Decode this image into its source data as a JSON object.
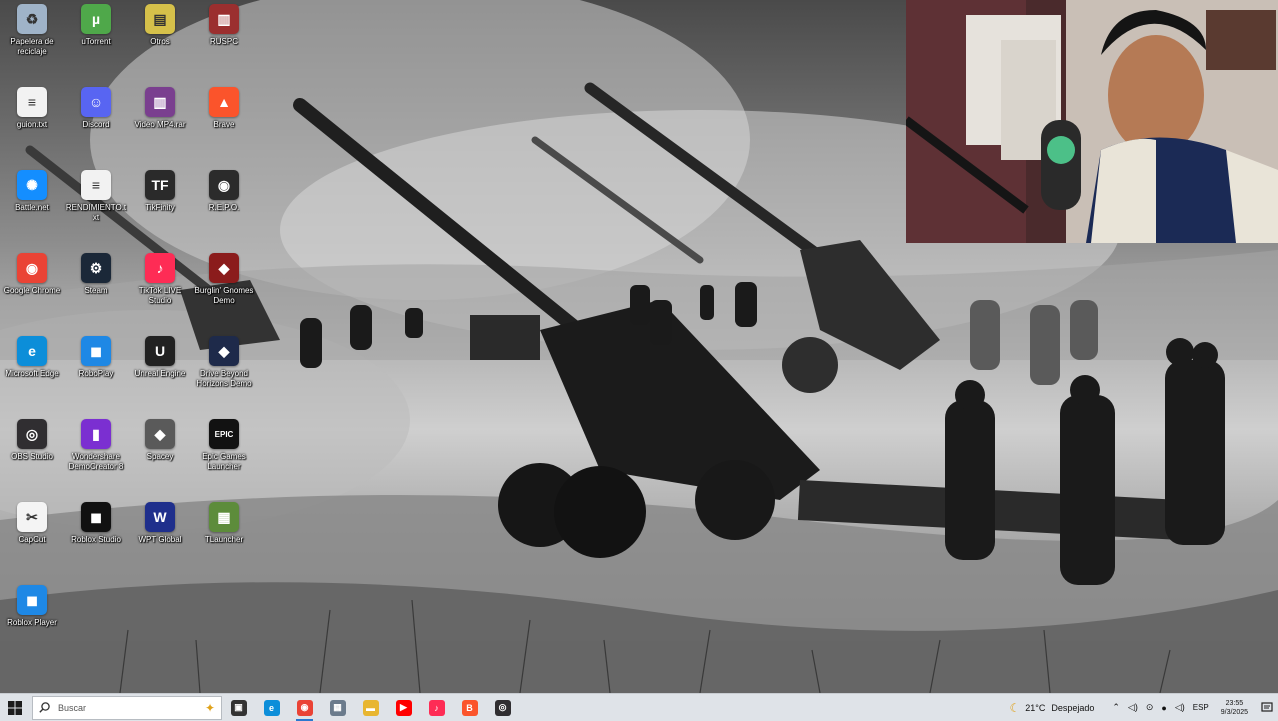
{
  "desktop": {
    "icons": [
      {
        "label": "Papelera de reciclaje",
        "icon": "recycle-bin-icon",
        "color": "#9fb3c8"
      },
      {
        "label": "uTorrent",
        "icon": "utorrent-icon",
        "color": "#4fa84a"
      },
      {
        "label": "Otros",
        "icon": "folder-icon",
        "color": "#d5c04a"
      },
      {
        "label": "RUSPC",
        "icon": "archive-icon",
        "color": "#9b2f2f"
      },
      {
        "label": "guion.txt",
        "icon": "text-file-icon",
        "color": "#f2f2f2"
      },
      {
        "label": "Discord",
        "icon": "discord-icon",
        "color": "#5865f2"
      },
      {
        "label": "Video MP4.rar",
        "icon": "winrar-icon",
        "color": "#7a3f8f"
      },
      {
        "label": "Brave",
        "icon": "brave-icon",
        "color": "#fb542b"
      },
      {
        "label": "Battle.net",
        "icon": "battlenet-icon",
        "color": "#148eff"
      },
      {
        "label": "RENDIMIENTO.txt",
        "icon": "text-file-icon",
        "color": "#f2f2f2"
      },
      {
        "label": "TikFinity",
        "icon": "tikfinity-icon",
        "color": "#2a2a2a"
      },
      {
        "label": "R.E.P.O.",
        "icon": "repo-icon",
        "color": "#2b2b2b"
      },
      {
        "label": "Google Chrome",
        "icon": "chrome-icon",
        "color": "#ea4335"
      },
      {
        "label": "Steam",
        "icon": "steam-icon",
        "color": "#1b2838"
      },
      {
        "label": "TikTok LIVE Studio",
        "icon": "tiktok-live-icon",
        "color": "#fe2c55"
      },
      {
        "label": "Burglin' Gnomes Demo",
        "icon": "game-icon",
        "color": "#8b1c1c"
      },
      {
        "label": "Microsoft Edge",
        "icon": "edge-icon",
        "color": "#0c8ed9"
      },
      {
        "label": "RoboPlay",
        "icon": "roblox-icon",
        "color": "#1e88e5"
      },
      {
        "label": "Unreal Engine",
        "icon": "unreal-icon",
        "color": "#222"
      },
      {
        "label": "Drive Beyond Horizons Demo",
        "icon": "game-icon",
        "color": "#1e2a4a"
      },
      {
        "label": "OBS Studio",
        "icon": "obs-icon",
        "color": "#302e31"
      },
      {
        "label": "Wondershare DemoCreator 8",
        "icon": "democreator-icon",
        "color": "#7b2fd1"
      },
      {
        "label": "Spacey",
        "icon": "app-icon",
        "color": "#5a5a5a"
      },
      {
        "label": "Epic Games Launcher",
        "icon": "epic-icon",
        "color": "#121212"
      },
      {
        "label": "CapCut",
        "icon": "capcut-icon",
        "color": "#f4f4f4"
      },
      {
        "label": "Roblox Studio",
        "icon": "roblox-studio-icon",
        "color": "#111"
      },
      {
        "label": "WPT Global",
        "icon": "wpt-icon",
        "color": "#1f2f8c"
      },
      {
        "label": "TLauncher",
        "icon": "minecraft-icon",
        "color": "#5d8c3b"
      },
      {
        "label": "Roblox Player",
        "icon": "roblox-icon",
        "color": "#1e88e5"
      }
    ]
  },
  "taskbar": {
    "search_placeholder": "Buscar",
    "apps": [
      {
        "name": "task-view",
        "icon": "task-view-icon",
        "color": "#333",
        "glyph": "▣"
      },
      {
        "name": "edge",
        "icon": "edge-icon",
        "color": "#0c8ed9",
        "glyph": "e"
      },
      {
        "name": "chrome",
        "icon": "chrome-icon",
        "color": "#ea4335",
        "glyph": "◉"
      },
      {
        "name": "calculator",
        "icon": "calculator-icon",
        "color": "#6b7b8c",
        "glyph": "▦"
      },
      {
        "name": "file-explorer",
        "icon": "folder-icon",
        "color": "#e8b631",
        "glyph": "▬"
      },
      {
        "name": "youtube",
        "icon": "youtube-icon",
        "color": "#ff0000",
        "glyph": "▶"
      },
      {
        "name": "tiktok",
        "icon": "tiktok-icon",
        "color": "#fe2c55",
        "glyph": "♪"
      },
      {
        "name": "brave",
        "icon": "brave-icon",
        "color": "#fb542b",
        "glyph": "B"
      },
      {
        "name": "obs",
        "icon": "obs-icon",
        "color": "#302e31",
        "glyph": "◎"
      }
    ],
    "weather_temp": "21°C",
    "weather_text": "Despejado",
    "language": "ESP",
    "time": "23:55",
    "date": "9/3/2025"
  }
}
